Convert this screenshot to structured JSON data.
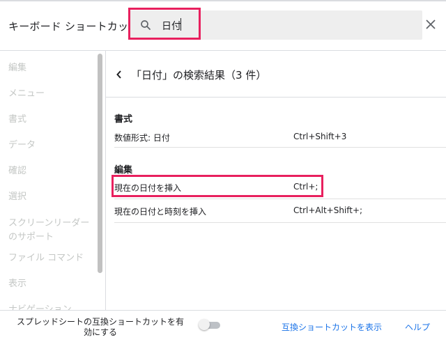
{
  "dialog": {
    "title": "キーボード ショートカット",
    "search_value": "日付"
  },
  "sidebar": {
    "items": [
      {
        "label": "編集"
      },
      {
        "label": "メニュー"
      },
      {
        "label": "書式"
      },
      {
        "label": "データ"
      },
      {
        "label": "確認"
      },
      {
        "label": "選択"
      },
      {
        "label": "スクリーンリーダーのサポート"
      },
      {
        "label": "ファイル コマンド"
      },
      {
        "label": "表示"
      },
      {
        "label": "ナビゲーション"
      }
    ]
  },
  "results": {
    "title": "「日付」の検索結果（3 件）",
    "sections": [
      {
        "heading": "書式",
        "rows": [
          {
            "action": "数値形式: 日付",
            "keys": "Ctrl+Shift+3"
          }
        ]
      },
      {
        "heading": "編集",
        "rows": [
          {
            "action": "現在の日付を挿入",
            "keys": "Ctrl+;"
          },
          {
            "action": "現在の日付と時刻を挿入",
            "keys": "Ctrl+Alt+Shift+;"
          }
        ]
      }
    ]
  },
  "footer": {
    "compat_label": "スプレッドシートの互換ショートカットを有効にする",
    "compat_enabled": false,
    "show_compat_link": "互換ショートカットを表示",
    "help_link": "ヘルプ"
  },
  "colors": {
    "highlight": "#e8205e",
    "link": "#1a73e8",
    "disabled_text": "#c4c7c5"
  }
}
